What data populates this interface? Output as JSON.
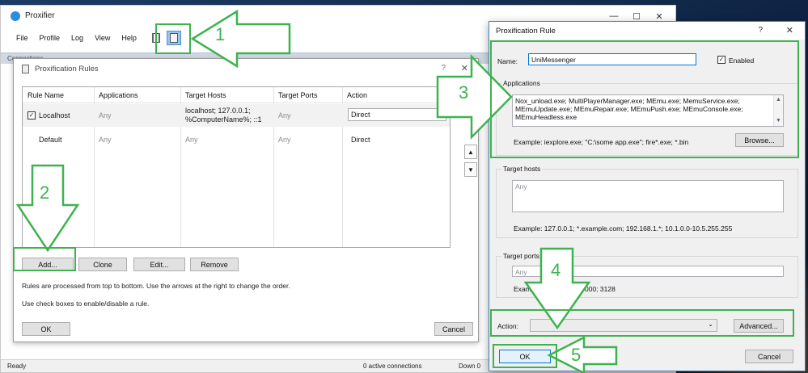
{
  "main_window": {
    "title": "Proxifier",
    "menu": [
      "File",
      "Profile",
      "Log",
      "View",
      "Help"
    ],
    "connections_label": "Connections",
    "status": {
      "left": "Ready",
      "connections": "0 active connections",
      "down": "Down 0"
    }
  },
  "rules_dialog": {
    "title": "Proxification Rules",
    "help": "?",
    "close": "✕",
    "columns": [
      "Rule Name",
      "Applications",
      "Target Hosts",
      "Target Ports",
      "Action"
    ],
    "rows": [
      {
        "name": "Localhost",
        "checked": true,
        "applications": "Any",
        "target_hosts_line1": "localhost; 127.0.0.1;",
        "target_hosts_line2": "%ComputerName%; ::1",
        "target_ports": "Any",
        "action": "Direct"
      },
      {
        "name": "Default",
        "applications": "Any",
        "target_hosts": "Any",
        "target_ports": "Any",
        "action": "Direct"
      }
    ],
    "buttons": {
      "add": "Add...",
      "clone": "Clone",
      "edit": "Edit...",
      "remove": "Remove",
      "ok": "OK",
      "cancel": "Cancel"
    },
    "hint1": "Rules are processed from top to bottom. Use the arrows at the right to change the order.",
    "hint2": "Use check boxes to enable/disable a rule."
  },
  "rule_dialog": {
    "title": "Proxification Rule",
    "help": "?",
    "close": "✕",
    "name_label": "Name:",
    "name_value": "UniMessenger",
    "enabled_label": "Enabled",
    "applications_label": "Applications",
    "applications_line1": "Nox_unload.exe; MultiPlayerManager.exe; MEmu.exe; MemuService.exe;",
    "applications_line2": "MEmuUpdate.exe; MEmuRepair.exe; MEmuPush.exe; MEmuConsole.exe;",
    "applications_line3": "MEmuHeadless.exe",
    "applications_example": "Example: iexplore.exe; \"C:\\some app.exe\"; fire*.exe; *.bin",
    "browse": "Browse...",
    "target_hosts_label": "Target hosts",
    "target_hosts_placeholder": "Any",
    "target_hosts_example": "Example: 127.0.0.1; *.example.com; 192.168.1.*; 10.1.0.0-10.5.255.255",
    "target_ports_label": "Target ports",
    "target_ports_placeholder": "Any",
    "target_ports_example_left": "Example",
    "target_ports_example_right": "000; 3128",
    "action_label": "Action:",
    "advanced": "Advanced...",
    "ok": "OK",
    "cancel": "Cancel"
  },
  "annotations": {
    "accent": "#3fb24f",
    "steps": [
      "1",
      "2",
      "3",
      "4",
      "5"
    ]
  }
}
